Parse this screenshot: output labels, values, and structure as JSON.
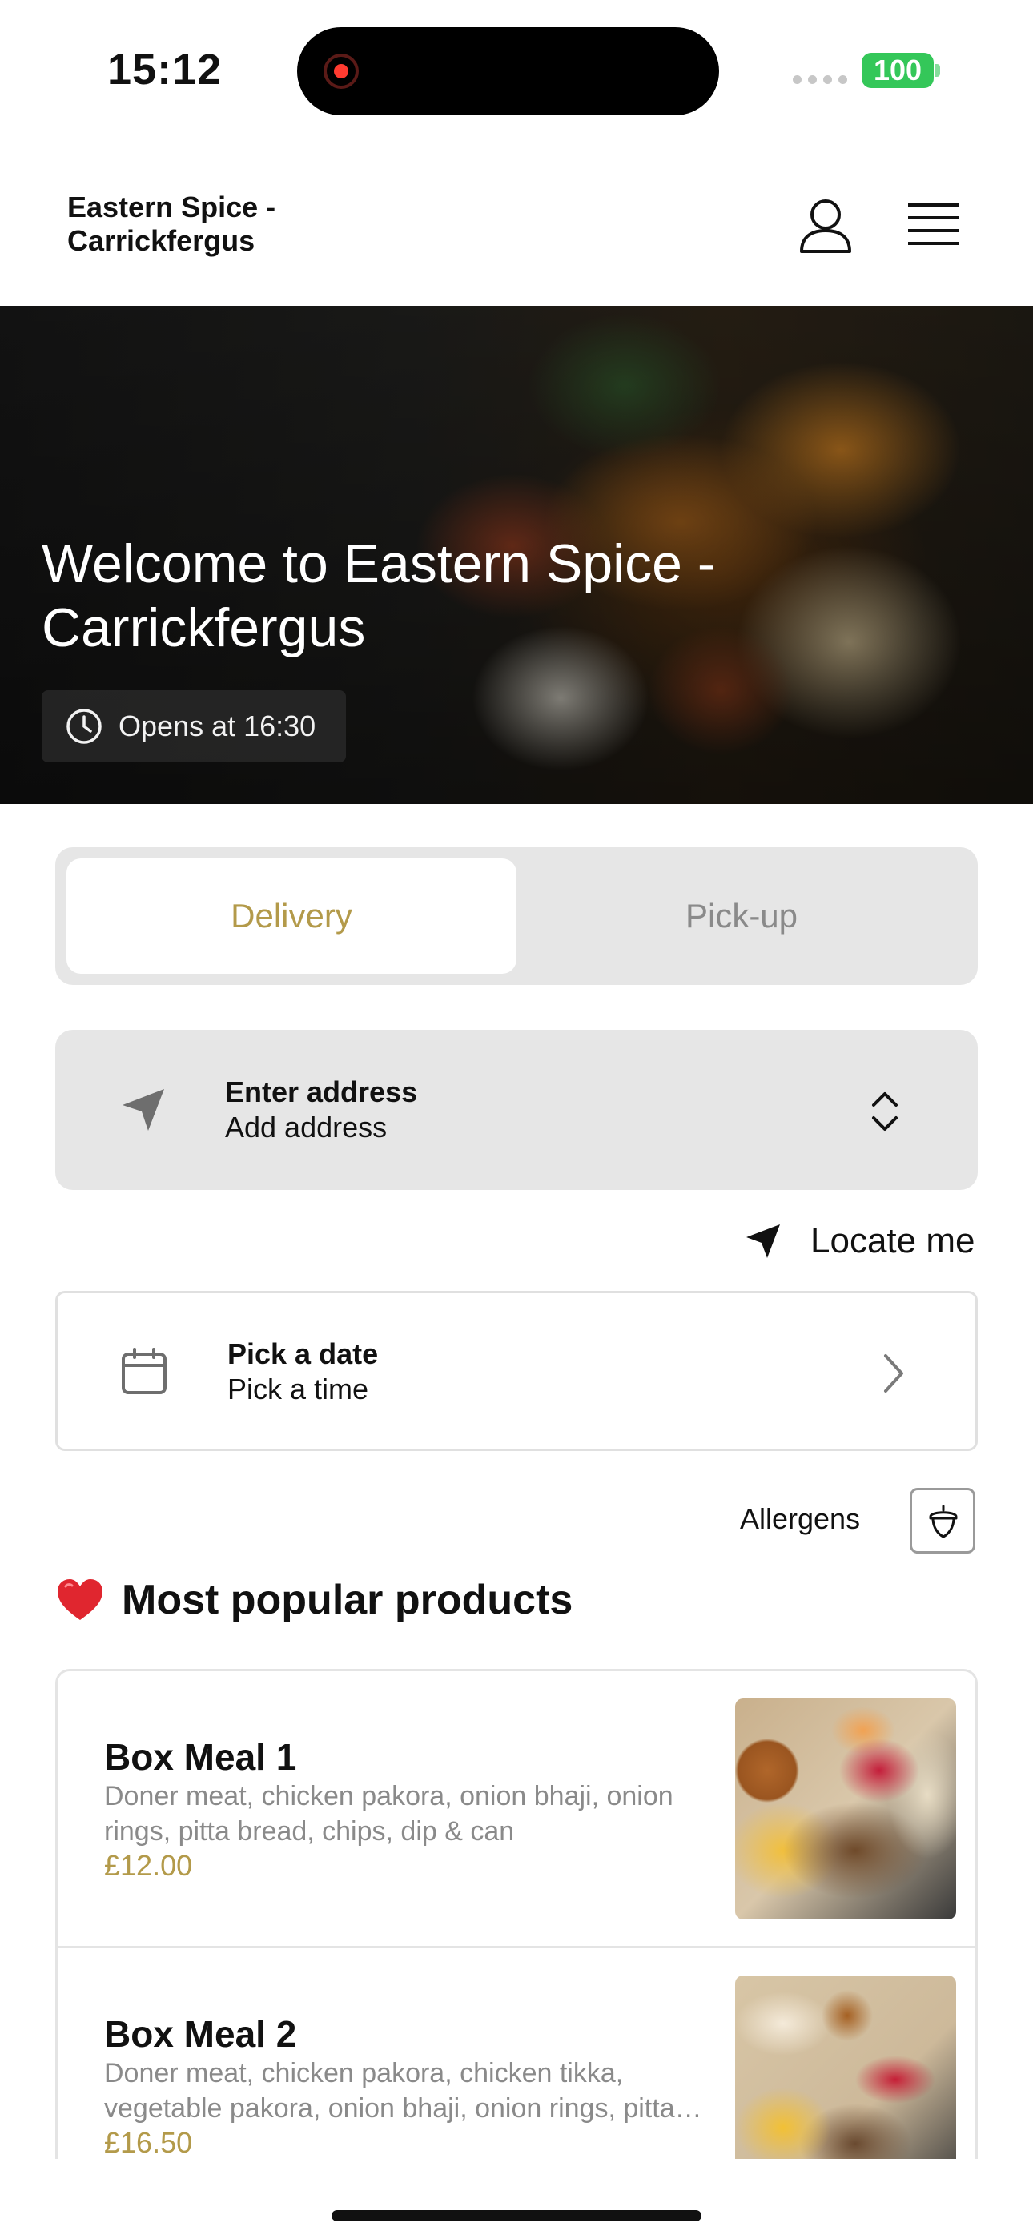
{
  "status_bar": {
    "time": "15:12",
    "battery": "100"
  },
  "header": {
    "restaurant_name": "Eastern Spice - Carrickfergus"
  },
  "hero": {
    "title": "Welcome to Eastern Spice - Carrickfergus",
    "opens_text": "Opens at 16:30"
  },
  "order_mode": {
    "tabs": [
      {
        "label": "Delivery",
        "selected": true
      },
      {
        "label": "Pick-up",
        "selected": false
      }
    ]
  },
  "address": {
    "title": "Enter address",
    "subtitle": "Add address"
  },
  "locate": {
    "label": "Locate me"
  },
  "schedule": {
    "title": "Pick a date",
    "subtitle": "Pick a time"
  },
  "allergens": {
    "label": "Allergens"
  },
  "popular": {
    "title": "Most popular products",
    "products": [
      {
        "name": "Box Meal 1",
        "description": "Doner meat, chicken pakora, onion bhaji, onion rings, pitta bread, chips, dip & can",
        "price": "£12.00"
      },
      {
        "name": "Box Meal 2",
        "description": "Doner meat, chicken pakora, chicken tikka, vegetable pakora, onion bhaji, onion rings, pitta bread, chips, dip & can",
        "price": "£16.50"
      }
    ]
  },
  "colors": {
    "accent": "#b39a4a",
    "segment_bg": "#e6e6e6",
    "battery": "#34c759",
    "recording": "#ff3b30"
  },
  "icons": [
    "user-icon",
    "menu-icon",
    "clock-icon",
    "navigation-arrow-icon",
    "chevron-up-down-icon",
    "locate-arrow-icon",
    "calendar-icon",
    "chevron-right-icon",
    "acorn-icon",
    "heart-icon"
  ]
}
